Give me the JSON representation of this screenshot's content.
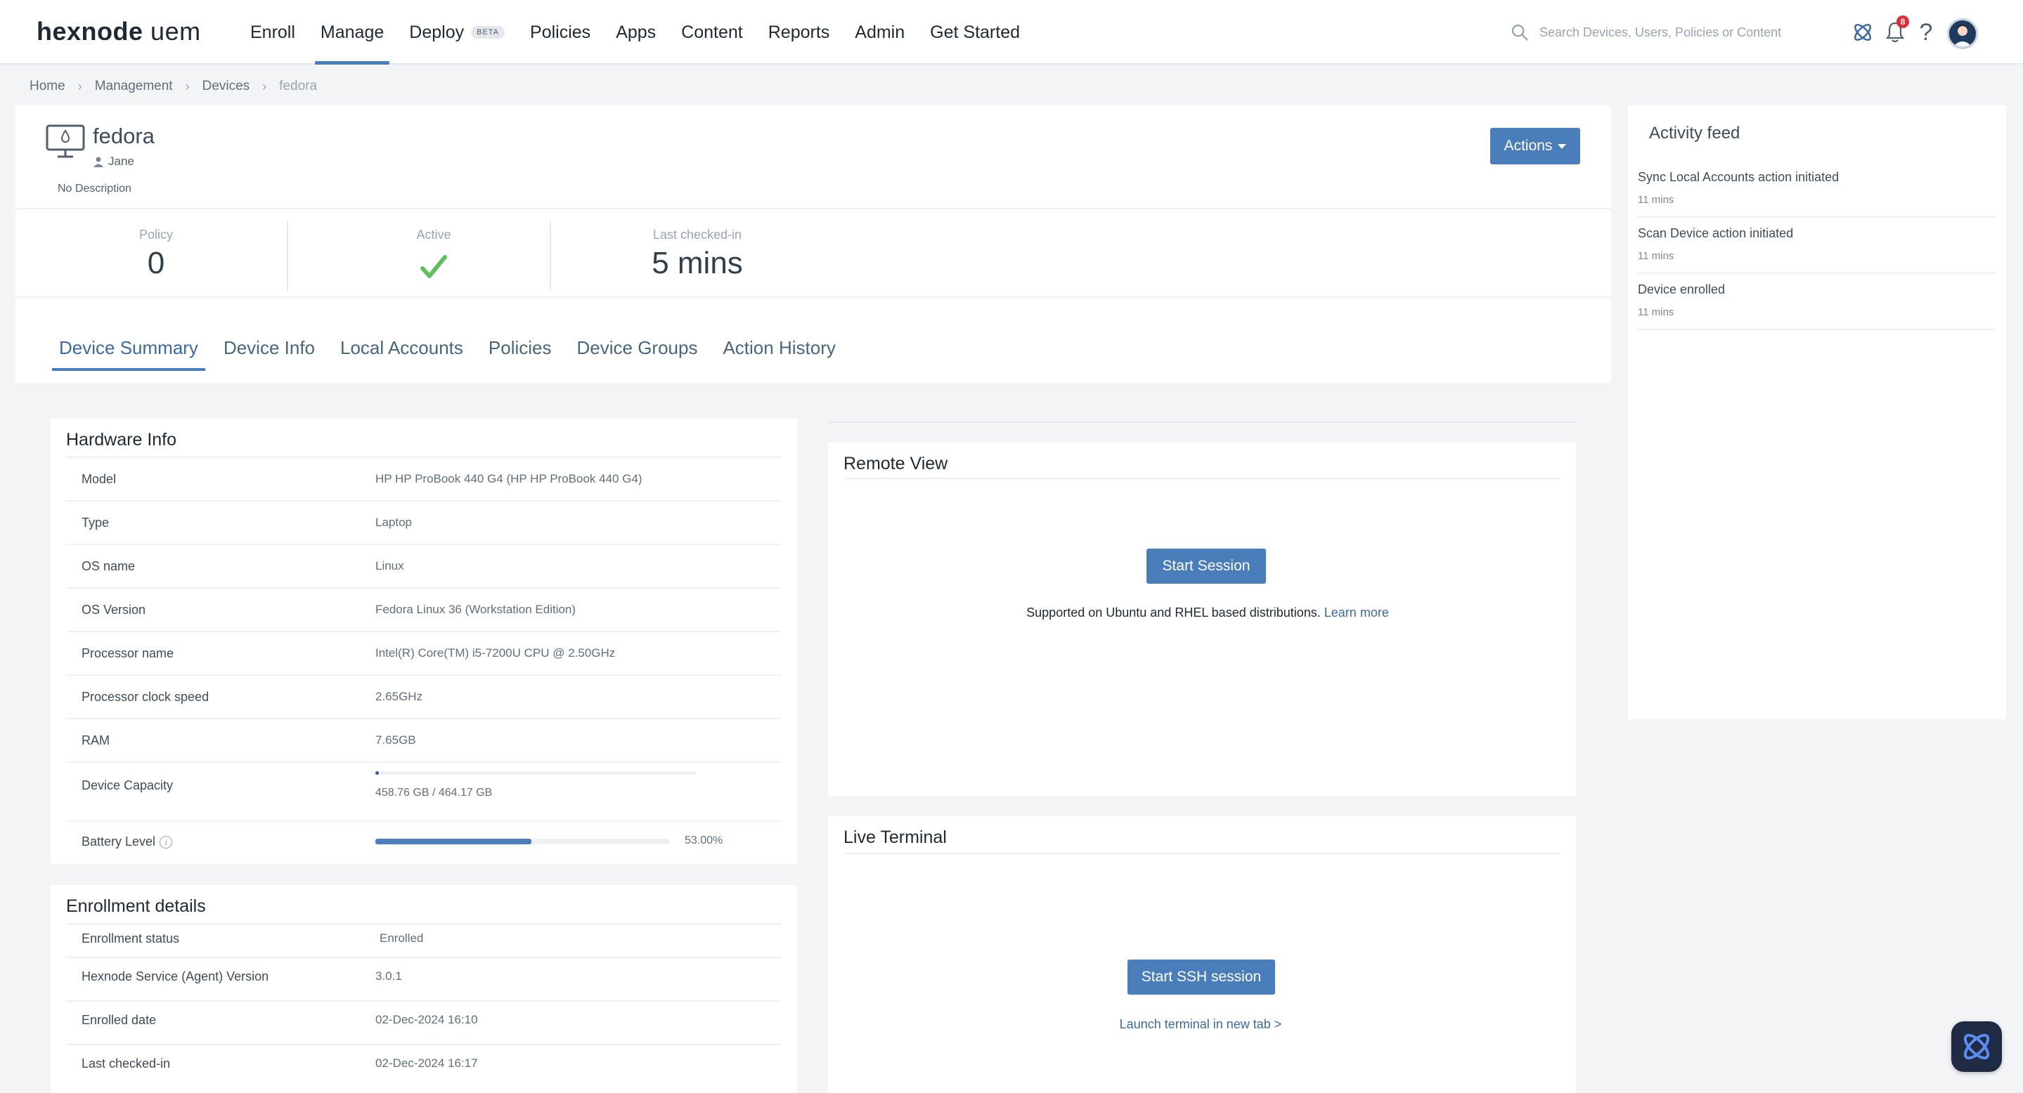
{
  "app": {
    "logo_main": "hexnode",
    "logo_sub": "uem"
  },
  "nav": {
    "items": [
      {
        "label": "Enroll"
      },
      {
        "label": "Manage",
        "active": true
      },
      {
        "label": "Deploy",
        "badge": "BETA"
      },
      {
        "label": "Policies"
      },
      {
        "label": "Apps"
      },
      {
        "label": "Content"
      },
      {
        "label": "Reports"
      },
      {
        "label": "Admin"
      },
      {
        "label": "Get Started"
      }
    ]
  },
  "search": {
    "placeholder": "Search Devices, Users, Policies or Content",
    "value": ""
  },
  "header_icons": {
    "notification_count": "8",
    "help": "?"
  },
  "breadcrumb": [
    "Home",
    "Management",
    "Devices",
    "fedora"
  ],
  "device": {
    "name": "fedora",
    "user": "Jane",
    "description": "No Description",
    "actions_label": "Actions"
  },
  "stats": {
    "policy_label": "Policy",
    "policy_value": "0",
    "active_label": "Active",
    "last_checkin_label": "Last checked-in",
    "last_checkin_value": "5 mins"
  },
  "tabs": [
    {
      "label": "Device Summary",
      "active": true
    },
    {
      "label": "Device Info"
    },
    {
      "label": "Local Accounts"
    },
    {
      "label": "Policies"
    },
    {
      "label": "Device Groups"
    },
    {
      "label": "Action History"
    }
  ],
  "hardware": {
    "title": "Hardware Info",
    "rows": [
      {
        "key": "Model",
        "value": "HP HP ProBook 440 G4 (HP HP ProBook 440 G4)"
      },
      {
        "key": "Type",
        "value": "Laptop"
      },
      {
        "key": "OS name",
        "value": "Linux"
      },
      {
        "key": "OS Version",
        "value": "Fedora Linux 36 (Workstation Edition)"
      },
      {
        "key": "Processor name",
        "value": "Intel(R) Core(TM) i5-7200U CPU @ 2.50GHz"
      },
      {
        "key": "Processor clock speed",
        "value": "2.65GHz"
      },
      {
        "key": "RAM",
        "value": "7.65GB"
      }
    ],
    "capacity_label": "Device Capacity",
    "capacity_text": "458.76 GB / 464.17 GB",
    "capacity_used_fraction": 0.011,
    "battery_label": "Battery Level",
    "battery_text": "53.00%",
    "battery_fraction": 0.53
  },
  "enrollment": {
    "title": "Enrollment details",
    "rows": [
      {
        "key": "Enrollment status",
        "value": "Enrolled"
      },
      {
        "key": "Hexnode Service (Agent) Version",
        "value": "3.0.1"
      },
      {
        "key": "Enrolled date",
        "value": "02-Dec-2024 16:10"
      },
      {
        "key": "Last checked-in",
        "value": "02-Dec-2024 16:17"
      }
    ]
  },
  "remote_view": {
    "title": "Remote View",
    "button": "Start Session",
    "note": "Supported on Ubuntu and RHEL based distributions.",
    "learn_more": "Learn more"
  },
  "live_terminal": {
    "title": "Live Terminal",
    "button": "Start SSH session",
    "launch_link": "Launch terminal in new tab >"
  },
  "activity_feed": {
    "title": "Activity feed",
    "items": [
      {
        "text": "Sync Local Accounts action initiated",
        "time": "11 mins"
      },
      {
        "text": "Scan Device action initiated",
        "time": "11 mins"
      },
      {
        "text": "Device enrolled",
        "time": "11 mins"
      }
    ]
  },
  "colors": {
    "accent": "#4a7ebb",
    "success": "#5cc15c",
    "badge": "#e12d39"
  }
}
